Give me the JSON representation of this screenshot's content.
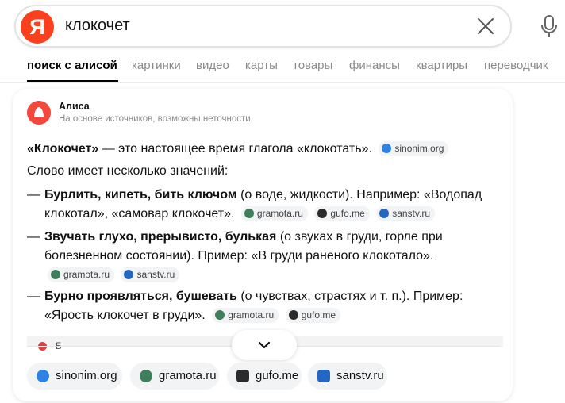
{
  "search": {
    "logo_letter": "Я",
    "query": "клокочет"
  },
  "tabs": [
    {
      "label": "поиск с алисой",
      "active": true
    },
    {
      "label": "картинки"
    },
    {
      "label": "видео"
    },
    {
      "label": "карты"
    },
    {
      "label": "товары"
    },
    {
      "label": "финансы"
    },
    {
      "label": "квартиры"
    },
    {
      "label": "переводчик"
    }
  ],
  "alice": {
    "name": "Алиса",
    "subtitle": "На основе источников, возможны неточности"
  },
  "answer": {
    "intro_bold": "«Клокочет»",
    "intro_rest": " — это настоящее время глагола «клокотать».",
    "intro_sources": [
      "sinonim.org"
    ],
    "meanings_title": "Слово имеет несколько значений:",
    "items": [
      {
        "bold": "Бурлить, кипеть, бить ключом",
        "rest": " (о воде, жидкости). Например: «Водопад клокотал», «самовар клокочет».",
        "sources": [
          "gramota.ru",
          "gufo.me",
          "sanstv.ru"
        ]
      },
      {
        "bold": "Звучать глухо, прерывисто, булькая",
        "rest": " (о звуках в груди, горле при болезненном состоянии). Пример: «В груди раненого клокотало».",
        "sources": [
          "gramota.ru",
          "sanstv.ru"
        ]
      },
      {
        "bold": "Бурно проявляться, бушевать",
        "rest": " (о чувствах, страстях и т. п.). Пример: «Ярость клокочет в груди».",
        "sources": [
          "gramota.ru",
          "gufo.me"
        ]
      }
    ],
    "truncated_letter": "Б"
  },
  "source_pills": [
    "sinonim.org",
    "gramota.ru",
    "gufo.me",
    "sanstv.ru"
  ],
  "colors": {
    "brand_red": "#fc3f1d",
    "alice_red": "#f5483d",
    "sinonim_blue": "#2e82e6",
    "gramota_green": "#3f7e5b",
    "sanstv_blue": "#2367c2"
  }
}
